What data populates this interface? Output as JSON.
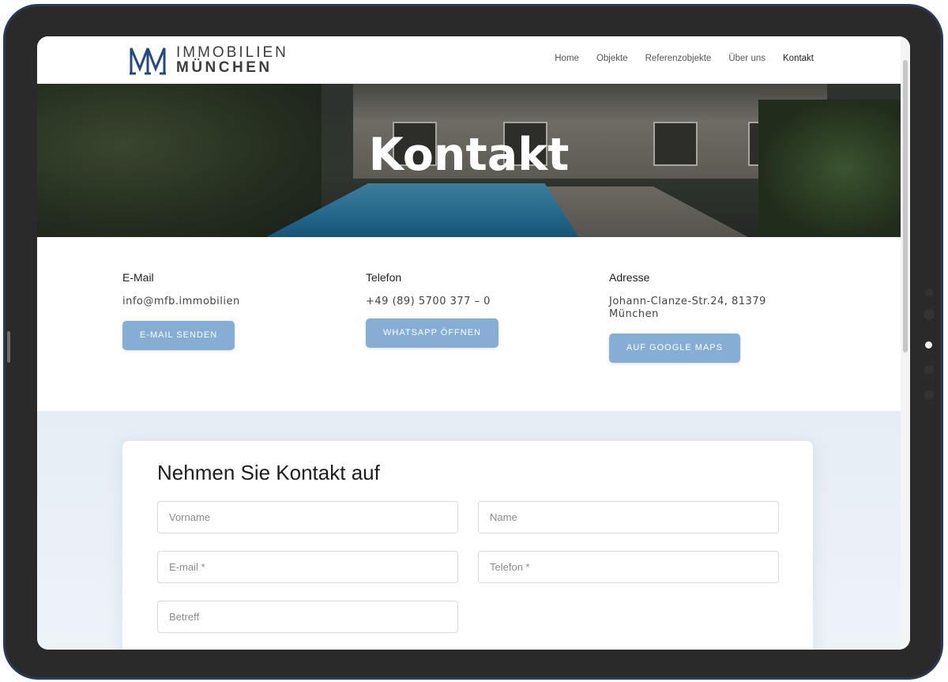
{
  "logo": {
    "line1": "IMMOBILIEN",
    "line2": "MÜNCHEN",
    "icon": "mfb-monogram-icon",
    "color": "#1f4a86"
  },
  "nav": {
    "items": [
      {
        "label": "Home"
      },
      {
        "label": "Objekte"
      },
      {
        "label": "Referenzobjekte"
      },
      {
        "label": "Über uns"
      },
      {
        "label": "Kontakt",
        "active": true
      }
    ]
  },
  "hero": {
    "title": "Kontakt"
  },
  "contact": {
    "email": {
      "title": "E-Mail",
      "value": "info@mfb.immobilien",
      "button": "E-MAIL SENDEN"
    },
    "phone": {
      "title": "Telefon",
      "value": "+49 (89) 5700 377 – 0",
      "button": "WHATSAPP ÖFFNEN"
    },
    "address": {
      "title": "Adresse",
      "value_line1": "Johann-Clanze-Str.24, 81379",
      "value_line2": "München",
      "button": "AUF GOOGLE MAPS"
    }
  },
  "form": {
    "title": "Nehmen Sie Kontakt auf",
    "fields": {
      "firstname": {
        "placeholder": "Vorname"
      },
      "name": {
        "placeholder": "Name"
      },
      "email": {
        "placeholder": "E-mail *"
      },
      "phone": {
        "placeholder": "Telefon *"
      },
      "subject": {
        "placeholder": "Betreff"
      }
    }
  },
  "colors": {
    "button": "#86aed5",
    "form_background": "#e6edf4",
    "frame": "#2a2a2a"
  }
}
